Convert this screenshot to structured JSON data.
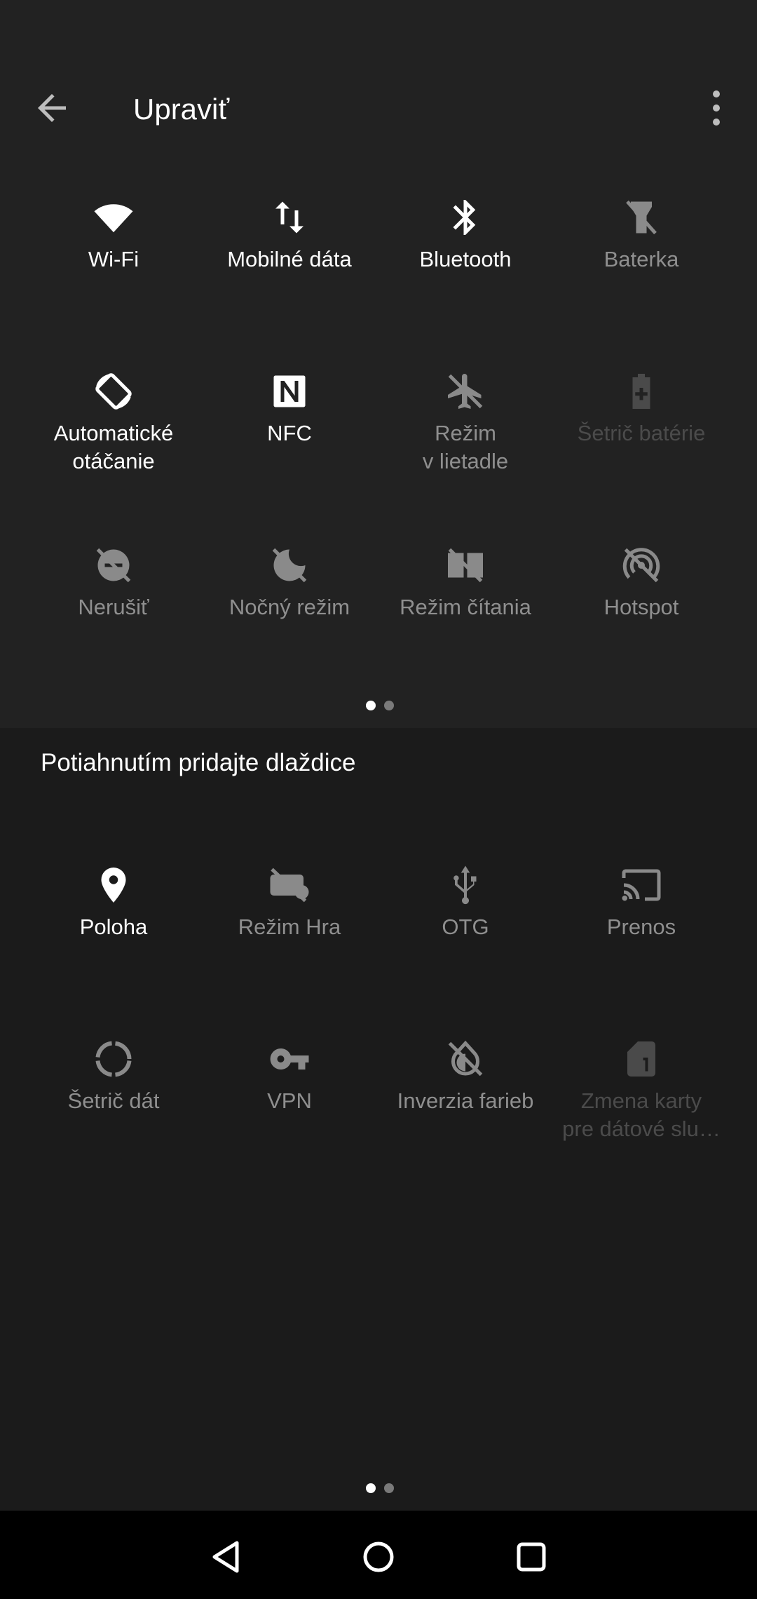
{
  "header": {
    "title": "Upraviť",
    "back_icon": "arrow-left-icon",
    "more_icon": "more-vert-icon"
  },
  "active_tiles": [
    {
      "label": "Wi-Fi",
      "icon": "wifi-icon",
      "state": "on"
    },
    {
      "label": "Mobilné dáta",
      "icon": "mobile-data-icon",
      "state": "on"
    },
    {
      "label": "Bluetooth",
      "icon": "bluetooth-icon",
      "state": "on"
    },
    {
      "label": "Baterka",
      "icon": "flashlight-off-icon",
      "state": "off"
    },
    {
      "label": "Automatické\notáčanie",
      "icon": "auto-rotate-icon",
      "state": "on"
    },
    {
      "label": "NFC",
      "icon": "nfc-icon",
      "state": "on"
    },
    {
      "label": "Režim\nv lietadle",
      "icon": "airplane-off-icon",
      "state": "off"
    },
    {
      "label": "Šetrič batérie",
      "icon": "battery-saver-icon",
      "state": "dim"
    },
    {
      "label": "Nerušiť",
      "icon": "do-not-disturb-off-icon",
      "state": "off"
    },
    {
      "label": "Nočný režim",
      "icon": "night-mode-off-icon",
      "state": "off"
    },
    {
      "label": "Režim čítania",
      "icon": "reading-mode-off-icon",
      "state": "off"
    },
    {
      "label": "Hotspot",
      "icon": "hotspot-off-icon",
      "state": "off"
    }
  ],
  "available_section": {
    "label": "Potiahnutím pridajte dlaždice"
  },
  "available_tiles": [
    {
      "label": "Poloha",
      "icon": "location-icon",
      "state": "on"
    },
    {
      "label": "Režim Hra",
      "icon": "game-mode-icon",
      "state": "off"
    },
    {
      "label": "OTG",
      "icon": "usb-icon",
      "state": "off"
    },
    {
      "label": "Prenos",
      "icon": "cast-icon",
      "state": "off"
    },
    {
      "label": "Šetrič dát",
      "icon": "data-saver-icon",
      "state": "off"
    },
    {
      "label": "VPN",
      "icon": "vpn-key-icon",
      "state": "off"
    },
    {
      "label": "Inverzia farieb",
      "icon": "invert-colors-icon",
      "state": "off"
    },
    {
      "label": "Zmena karty\npre dátové slu…",
      "icon": "sim-card-switch-icon",
      "state": "dim"
    }
  ],
  "pagination": {
    "pages": 2,
    "current": 1
  },
  "navbar": {
    "back_icon": "nav-back-icon",
    "home_icon": "nav-home-icon",
    "recents_icon": "nav-recents-icon"
  }
}
